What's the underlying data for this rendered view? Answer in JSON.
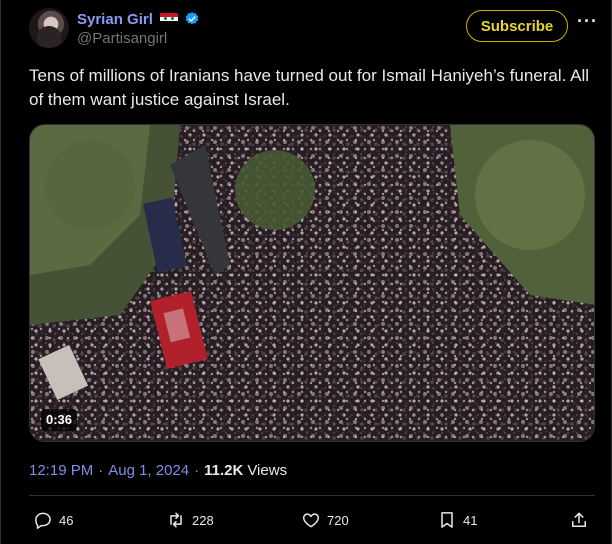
{
  "author": {
    "display_name": "Syrian Girl",
    "handle": "@Partisangirl",
    "flag_icon": "syria-flag-icon",
    "verified_icon": "verified-badge-icon"
  },
  "header": {
    "subscribe_label": "Subscribe",
    "more_icon": "more-options-icon"
  },
  "tweet": {
    "text": "Tens of millions of Iranians have turned out for Ismail Haniyeh’s funeral. All of them want justice against Israel."
  },
  "media": {
    "duration": "0:36",
    "banner_text": ""
  },
  "meta": {
    "time": "12:19 PM",
    "separator": "·",
    "date": "Aug 1, 2024",
    "separator2": "·",
    "views_count": "11.2K",
    "views_label": "Views"
  },
  "actions": {
    "replies": "46",
    "reposts": "228",
    "likes": "720",
    "bookmarks": "41"
  },
  "colors": {
    "accent": "#8a9af0",
    "subscribe": "#e7d52a",
    "background": "#000000"
  }
}
